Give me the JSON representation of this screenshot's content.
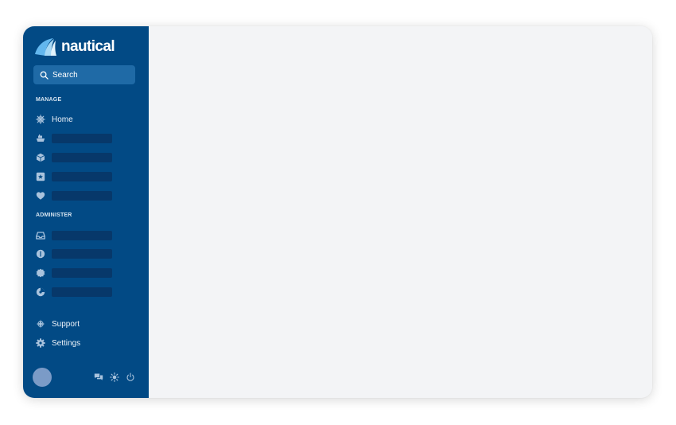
{
  "app": {
    "brand": "nautical",
    "accent_color": "#024a85",
    "main_background": "#f3f4f6"
  },
  "search": {
    "label": "Search",
    "icon": "search-icon"
  },
  "sidebar": {
    "manage": {
      "title": "MANAGE",
      "items": [
        {
          "label": "Home",
          "icon": "ship-wheel-icon"
        },
        {
          "label": "",
          "icon": "boat-icon"
        },
        {
          "label": "",
          "icon": "box-icon"
        },
        {
          "label": "",
          "icon": "star-square-icon"
        },
        {
          "label": "",
          "icon": "heart-icon"
        }
      ]
    },
    "administer": {
      "title": "ADMINISTER",
      "items": [
        {
          "label": "",
          "icon": "inbox-icon"
        },
        {
          "label": "",
          "icon": "dollar-circle-icon"
        },
        {
          "label": "",
          "icon": "badge-icon"
        },
        {
          "label": "",
          "icon": "pie-chart-icon"
        }
      ]
    },
    "bottom": {
      "items": [
        {
          "label": "Support",
          "icon": "compass-icon"
        },
        {
          "label": "Settings",
          "icon": "gear-icon"
        }
      ]
    }
  },
  "footer": {
    "icons": [
      "chat-icon",
      "sun-icon",
      "power-icon"
    ]
  }
}
